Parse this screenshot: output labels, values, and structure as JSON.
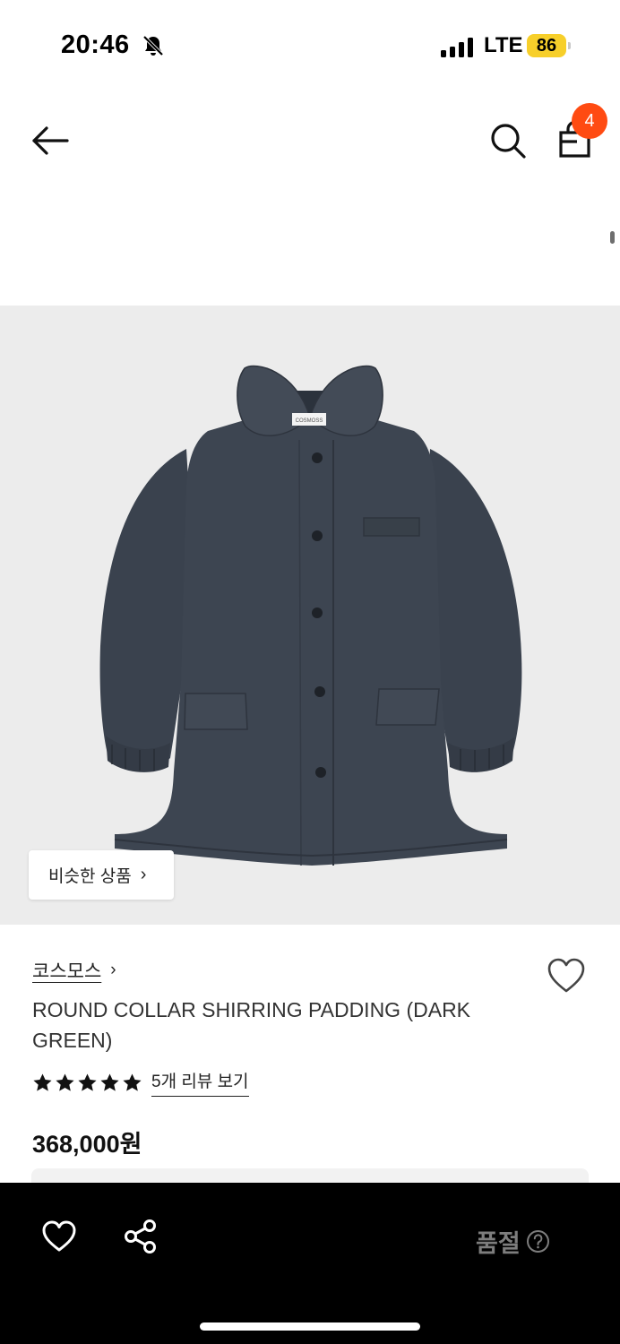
{
  "status_bar": {
    "time": "20:46",
    "network": "LTE",
    "battery": "86",
    "icons": [
      "bell-off-icon",
      "signal-icon",
      "battery-icon"
    ],
    "battery_color": "#f7cf2a"
  },
  "header": {
    "icons": [
      "back-arrow-icon",
      "search-icon",
      "shopping-bag-icon"
    ],
    "cart_count": "4",
    "badge_color": "#ff4b12"
  },
  "hero": {
    "similar_label": "비슷한 상품",
    "jacket_tag": "COSMOSS",
    "background": "#ececec"
  },
  "product": {
    "brand": "코스모스",
    "title": "ROUND COLLAR SHIRRING PADDING (DARK GREEN)",
    "rating": 5,
    "rating_max": 5,
    "review_link": "5개 리뷰 보기",
    "price": "368,000원"
  },
  "bottom_bar": {
    "status_label": "품절",
    "icons": [
      "heart-icon",
      "share-icon",
      "help-icon"
    ]
  }
}
